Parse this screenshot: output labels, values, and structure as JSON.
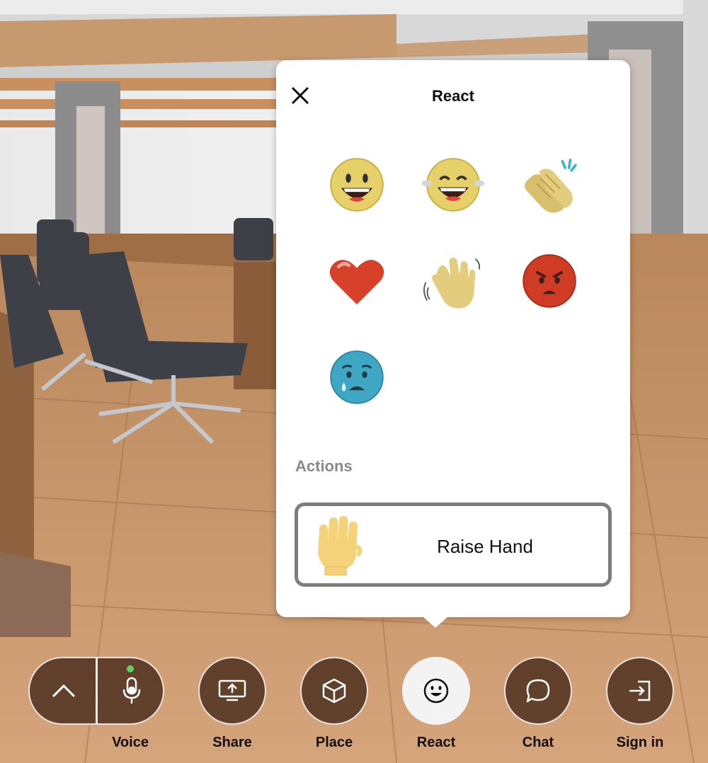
{
  "panel": {
    "title": "React",
    "actions_heading": "Actions",
    "raise_hand_label": "Raise Hand"
  },
  "reactions": [
    {
      "name": "grinning-face"
    },
    {
      "name": "laughing-tears-face"
    },
    {
      "name": "clapping-hands"
    },
    {
      "name": "red-heart"
    },
    {
      "name": "waving-hand"
    },
    {
      "name": "angry-face"
    },
    {
      "name": "sad-tear-face"
    }
  ],
  "toolbar": {
    "voice": "Voice",
    "share": "Share",
    "place": "Place",
    "react": "React",
    "chat": "Chat",
    "sign_in": "Sign in"
  },
  "colors": {
    "panel_bg": "#ffffff",
    "toolbar_button_bg": "#4e3020",
    "active_button_bg": "#f3f3f3",
    "mic_live_indicator": "#5fd35f",
    "section_label": "#8a8a8a"
  }
}
